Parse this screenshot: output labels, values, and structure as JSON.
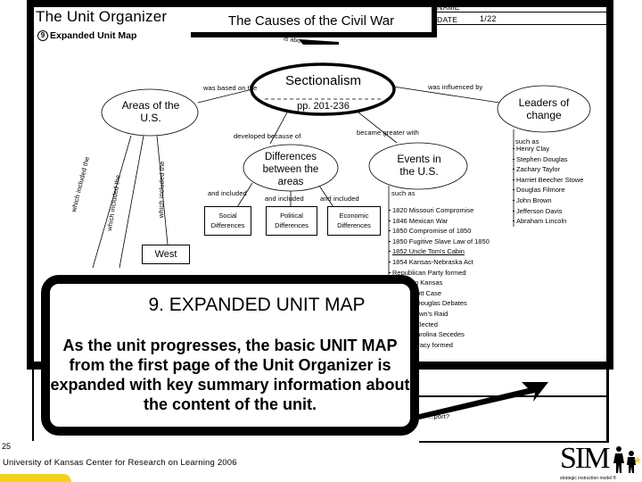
{
  "header": {
    "organizer_title": "The Unit Organizer",
    "unit_topic": "The Causes of the Civil War",
    "name_label": "NAME",
    "name_value": "",
    "date_label": "DATE",
    "date_value": "1/22",
    "section_number": "9",
    "section_title": "Expanded Unit Map"
  },
  "map": {
    "center": {
      "title": "Sectionalism",
      "pages": "pp. 201-236"
    },
    "link_is_about": "is about",
    "link_based_on": "was based on the",
    "link_influenced_by": "was influenced by",
    "link_developed_because": "developed because of",
    "link_became_greater": "became greater with",
    "areas_oval": "Areas of the U.S.",
    "leaders_oval": "Leaders of change",
    "differences_oval": "Differences between the areas",
    "events_oval": "Events in the U.S.",
    "areas_links": [
      "which included the",
      "which included the",
      "which included the"
    ],
    "west_box": "West",
    "and_included": "and included",
    "difference_boxes": [
      "Social Differences",
      "Political Differences",
      "Economic Differences"
    ],
    "events_such_as": "such as",
    "events": [
      "1820 Missouri Compromise",
      "1846 Mexican War",
      "1850 Compromise of 1850",
      "1850 Fugitive Slave Law of 1850",
      "1852 Uncle Tom's Cabin",
      "1854 Kansas-Nebraska Act",
      "Republican Party formed",
      "Bleeding Kansas",
      "Dred Scott Case",
      "Lincoln-Douglas Debates",
      "John Brown's Raid",
      "Lincoln Elected",
      "South Carolina Secedes",
      "Confederacy formed"
    ],
    "leaders_such_as": "such as",
    "leaders": [
      "Henry Clay",
      "Stephen Douglas",
      "Zachary Taylor",
      "Harriet Beecher Stowe",
      "Douglas Filmore",
      "John Brown",
      "Jefferson Davis",
      "Abraham Lincoln"
    ],
    "partial_question": "...port?"
  },
  "callout": {
    "title": "9. EXPANDED UNIT MAP",
    "body": "As the unit progresses, the basic UNIT MAP from the first page of the Unit Organizer is expanded with key summary information about the content of the unit."
  },
  "footer": {
    "page_number": "25",
    "credit": "University of Kansas Center for Research on Learning  2006",
    "logo_text": "SIM",
    "logo_subtitle": "strategic instruction model ®"
  }
}
